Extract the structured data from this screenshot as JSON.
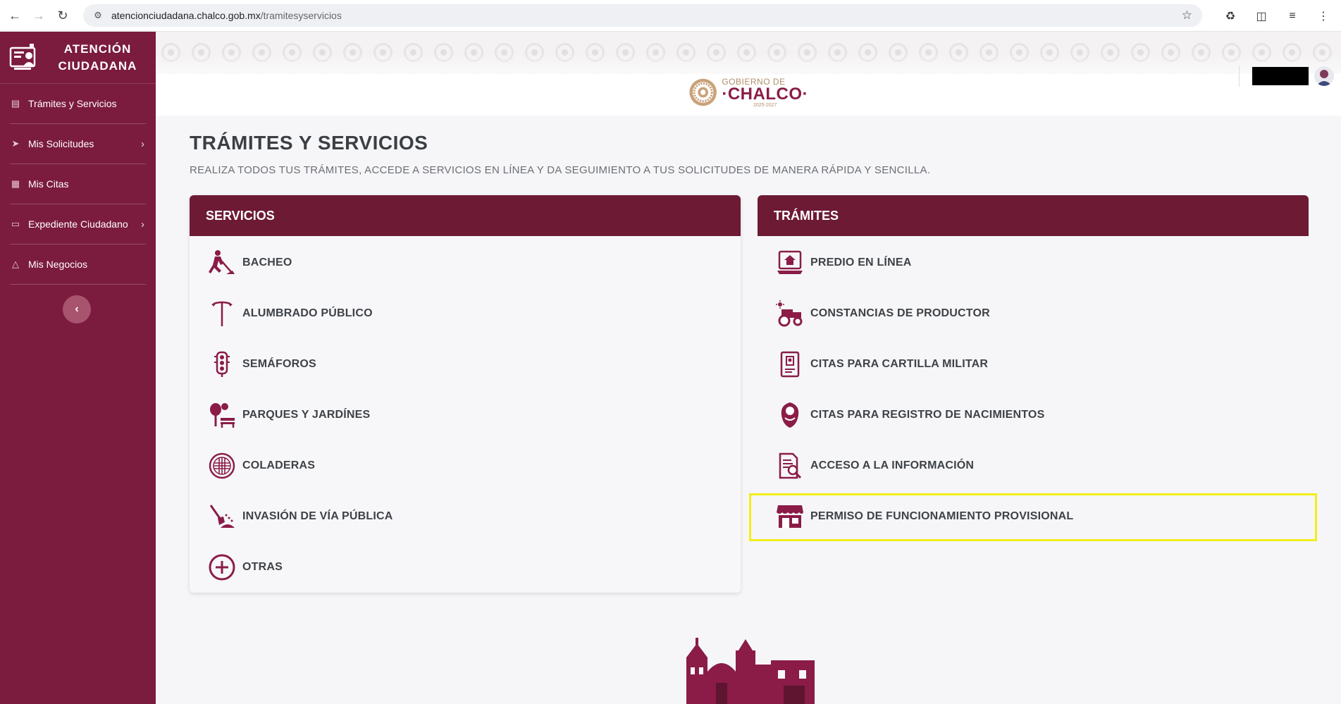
{
  "browser": {
    "url_domain": "atencionciudadana.chalco.gob.mx",
    "url_path": "/tramitesyservicios"
  },
  "sidebar": {
    "brand_line1": "ATENCIÓN",
    "brand_line2": "CIUDADANA",
    "items": [
      {
        "label": "Trámites y Servicios",
        "icon": "list-icon",
        "has_chevron": false
      },
      {
        "label": "Mis Solicitudes",
        "icon": "send-icon",
        "has_chevron": true
      },
      {
        "label": "Mis Citas",
        "icon": "calendar-icon",
        "has_chevron": false
      },
      {
        "label": "Expediente Ciudadano",
        "icon": "folder-icon",
        "has_chevron": true
      },
      {
        "label": "Mis Negocios",
        "icon": "basket-icon",
        "has_chevron": false
      }
    ]
  },
  "header": {
    "logo_small": "GOBIERNO DE",
    "logo_big": "·CHALCO·",
    "logo_years": "2025-2027"
  },
  "main": {
    "title": "TRÁMITES Y SERVICIOS",
    "subtitle": "REALIZA TODOS TUS TRÁMITES, ACCEDE A SERVICIOS EN LÍNEA Y DA SEGUIMIENTO A TUS SOLICITUDES DE MANERA RÁPIDA Y SENCILLA.",
    "servicios": {
      "heading": "SERVICIOS",
      "items": [
        {
          "label": "BACHEO",
          "icon": "worker-digging-icon"
        },
        {
          "label": "ALUMBRADO PÚBLICO",
          "icon": "street-lamp-icon"
        },
        {
          "label": "SEMÁFOROS",
          "icon": "traffic-light-icon"
        },
        {
          "label": "PARQUES Y JARDÍNES",
          "icon": "park-tree-icon"
        },
        {
          "label": "COLADERAS",
          "icon": "drain-grate-icon"
        },
        {
          "label": "INVASIÓN DE VÍA PÚBLICA",
          "icon": "shovel-debris-icon"
        },
        {
          "label": "OTRAS",
          "icon": "plus-circle-icon"
        }
      ]
    },
    "tramites": {
      "heading": "TRÁMITES",
      "items": [
        {
          "label": "PREDIO EN LÍNEA",
          "icon": "laptop-house-icon"
        },
        {
          "label": "CONSTANCIAS DE PRODUCTOR",
          "icon": "tractor-icon"
        },
        {
          "label": "CITAS PARA CARTILLA MILITAR",
          "icon": "military-id-icon"
        },
        {
          "label": "CITAS PARA REGISTRO DE NACIMIENTOS",
          "icon": "baby-icon"
        },
        {
          "label": "ACCESO A LA INFORMACIÓN",
          "icon": "document-search-icon"
        },
        {
          "label": "PERMISO DE FUNCIONAMIENTO PROVISIONAL",
          "icon": "storefront-icon"
        }
      ]
    }
  },
  "colors": {
    "brand": "#7b1b3e",
    "card_header": "#6d1a35",
    "icon": "#8a1c47",
    "highlight": "#f1ee1a"
  }
}
